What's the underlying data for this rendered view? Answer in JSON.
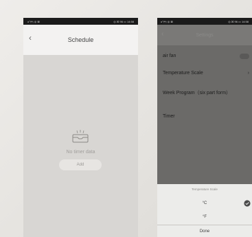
{
  "schedule": {
    "status_left": "o°ᵢᵃᵢⁿᵢ ◎ ⊠",
    "status_right": "◎ ☒ 96 ▭ 14:58",
    "title": "Schedule",
    "empty_text": "No timer data",
    "add_label": "Add"
  },
  "settings": {
    "status_left": "o°ᵢᵃᵢⁿᵢ ◎ ⊠",
    "status_right": "◎ ☒ 96 ▭ 14:58",
    "title": "Settings",
    "items": [
      {
        "label": "air fan"
      },
      {
        "label": "Temperature Scale"
      },
      {
        "label": "Week Program（six part form）"
      },
      {
        "label": "Timer"
      }
    ],
    "sheet": {
      "title": "Temperature Scale",
      "options": [
        {
          "label": "°C",
          "selected": true
        },
        {
          "label": "°F",
          "selected": false
        }
      ],
      "done_label": "Done"
    }
  },
  "colors": {
    "accent_check": "#4a4a4a"
  }
}
